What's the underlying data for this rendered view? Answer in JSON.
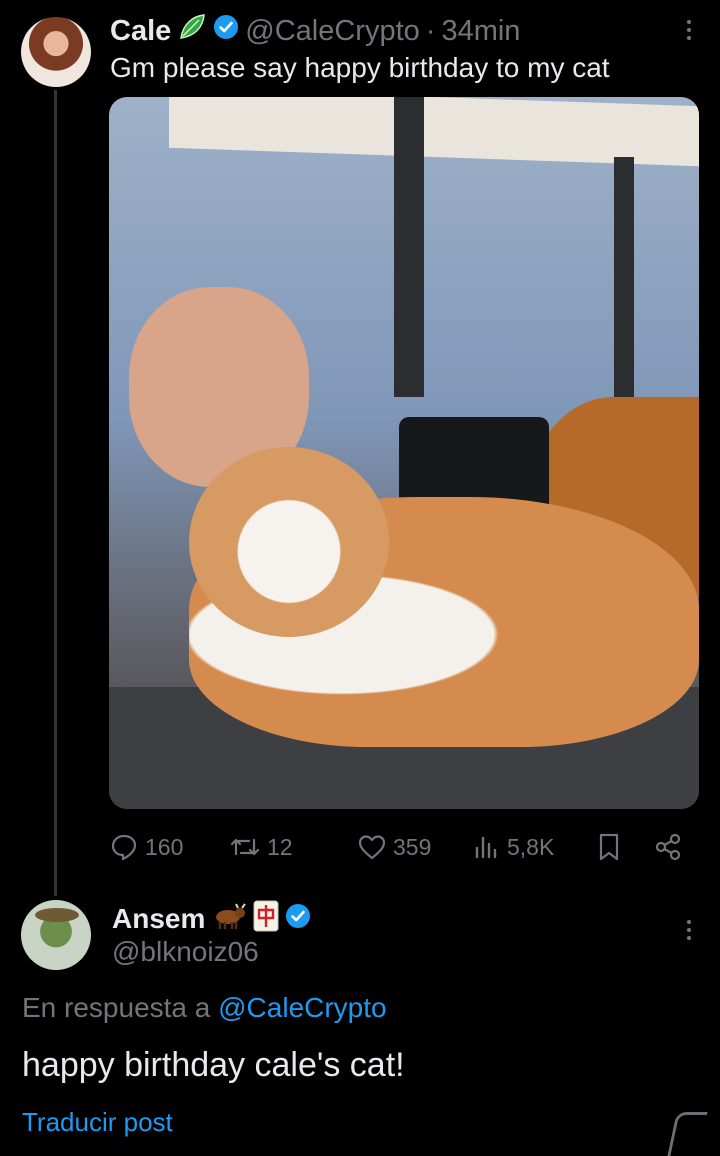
{
  "tweet": {
    "author_name": "Cale",
    "author_emoji_icon": "green-leaf-emoji",
    "handle": "@CaleCrypto",
    "separator": "·",
    "time": "34min",
    "text": "Gm please say happy birthday to my cat",
    "media_description_icon": "photo-cat-and-person",
    "stats": {
      "replies": "160",
      "reposts": "12",
      "likes": "359",
      "views": "5,8K"
    }
  },
  "reply": {
    "author_name": "Ansem",
    "author_emojis": [
      "ox-emoji",
      "mahjong-red-dragon-emoji"
    ],
    "handle": "@blknoiz06",
    "reply_prefix": "En respuesta a",
    "reply_to_handle": "@CaleCrypto",
    "text": "happy birthday cale's cat!",
    "translate_label": "Traducir post"
  },
  "colors": {
    "background": "#000000",
    "primary_text": "#e7e9ea",
    "secondary_text": "#71767b",
    "link": "#1d9bf0",
    "verified": "#1d9bf0",
    "leaf_emoji": "#2fa84f"
  }
}
